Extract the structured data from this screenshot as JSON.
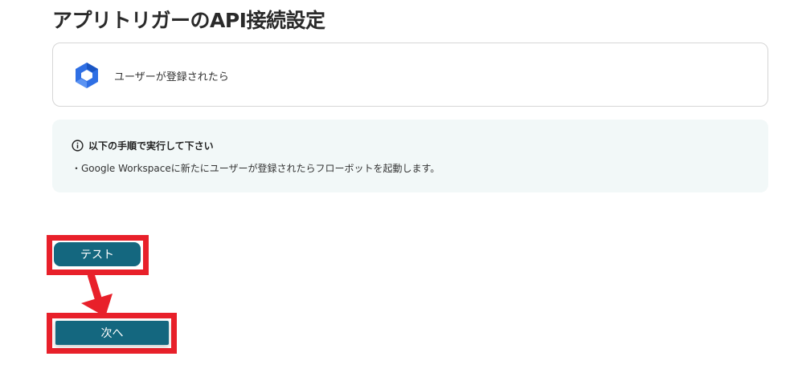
{
  "page": {
    "title": "アプリトリガーのAPI接続設定"
  },
  "trigger": {
    "icon": "google-workspace-icon",
    "label": "ユーザーが登録されたら"
  },
  "info": {
    "icon": "info-circle-icon",
    "heading": "以下の手順で実行して下さい",
    "body": "・Google Workspaceに新たにユーザーが登録されたらフローボットを起動します。"
  },
  "buttons": {
    "test_label": "テスト",
    "next_label": "次へ"
  },
  "annotations": {
    "highlight_color": "#e8202a",
    "button_color": "#14677f"
  }
}
